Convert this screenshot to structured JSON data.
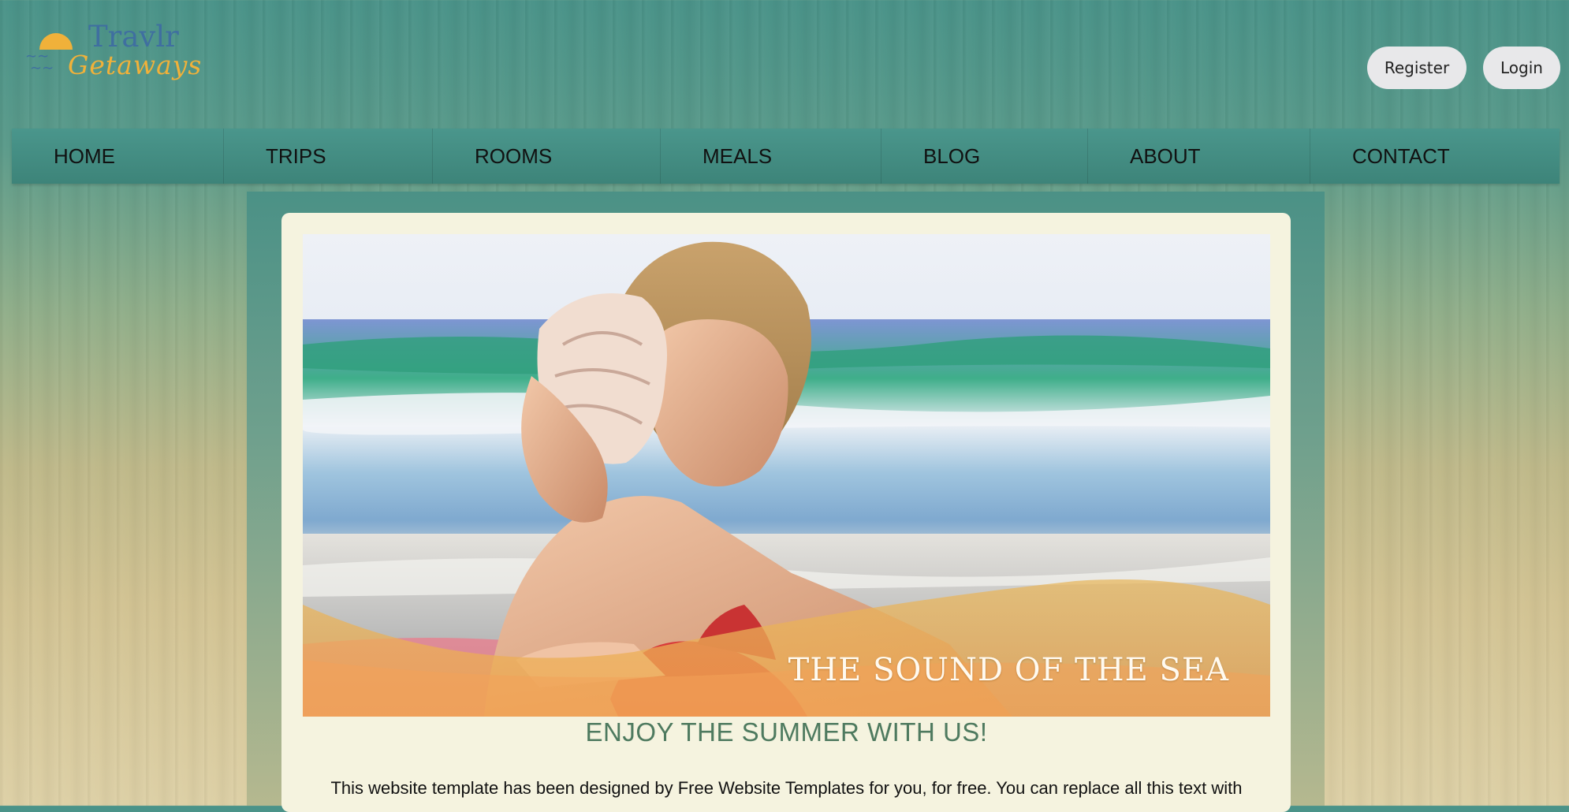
{
  "header": {
    "logo": {
      "line1": "Travlr",
      "line2": "Getaways"
    },
    "register_label": "Register",
    "login_label": "Login"
  },
  "nav": {
    "items": [
      "HOME",
      "TRIPS",
      "ROOMS",
      "MEALS",
      "BLOG",
      "ABOUT",
      "CONTACT"
    ]
  },
  "hero": {
    "caption": "THE SOUND OF THE SEA"
  },
  "main": {
    "headline": "ENJOY THE SUMMER WITH US!",
    "intro": "This website template has been designed by Free Website Templates for you, for free. You can replace all this text with"
  },
  "colors": {
    "nav_bg": "#3f8a7f",
    "logo_blue": "#3f6fa0",
    "logo_orange": "#f0b13a",
    "headline_green": "#4e7a5f",
    "card_bg": "#f5f3df"
  }
}
